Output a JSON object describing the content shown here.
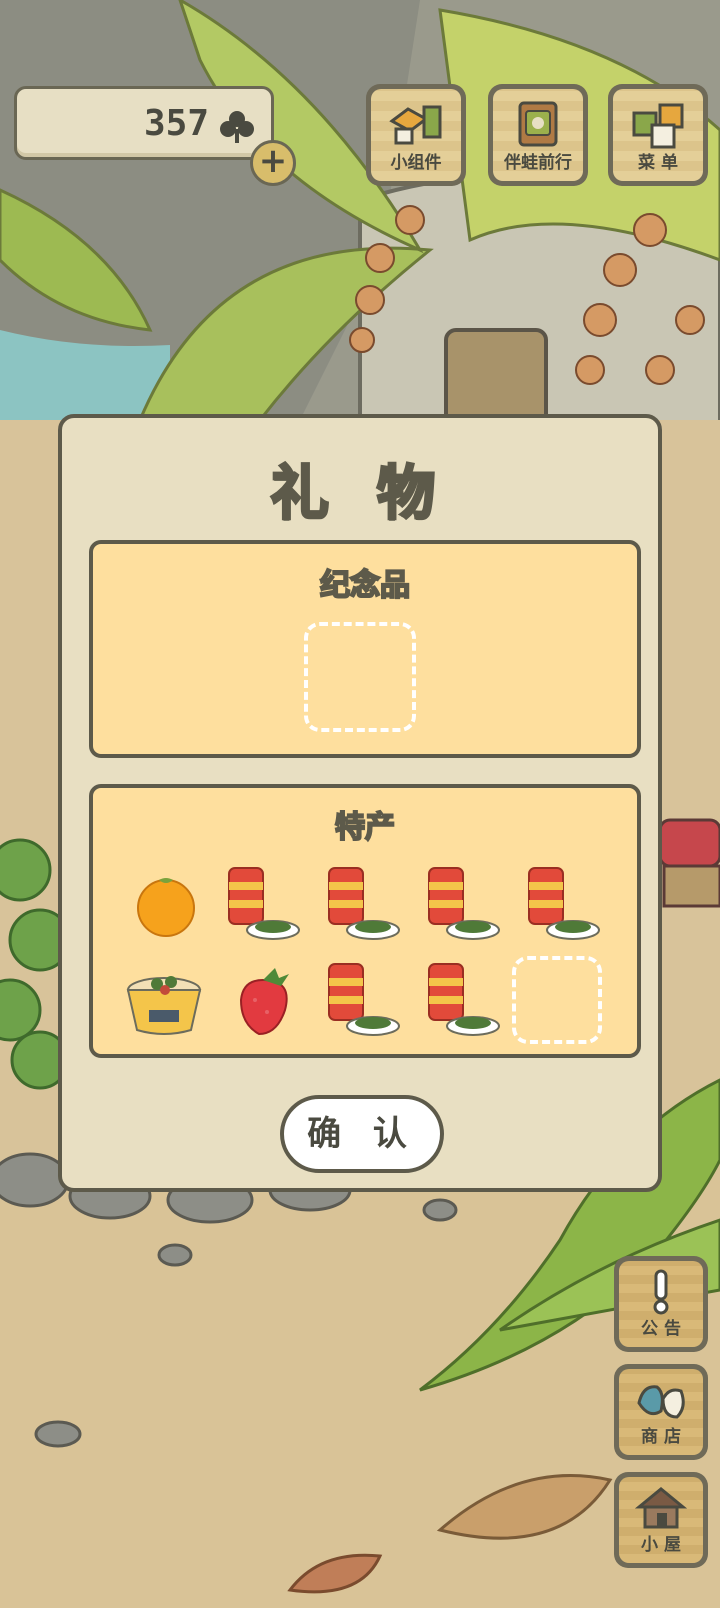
{
  "header": {
    "clover_count": "357",
    "add_clover_label": "+",
    "buttons": [
      {
        "label": "小组件",
        "icon": "widget-icon"
      },
      {
        "label": "伴蛙前行",
        "icon": "frog-journey-icon"
      },
      {
        "label": "菜 单",
        "icon": "menu-icon"
      }
    ]
  },
  "side_buttons": [
    {
      "label": "公 告",
      "icon": "exclamation-icon"
    },
    {
      "label": "商 店",
      "icon": "shop-bags-icon"
    },
    {
      "label": "小 屋",
      "icon": "house-icon"
    }
  ],
  "dialog": {
    "title": "礼 物",
    "souvenir": {
      "title": "纪念品",
      "slots": [
        "empty"
      ]
    },
    "specialty": {
      "title": "特产",
      "items": [
        "orange-icon",
        "canned-food-icon",
        "canned-food-icon",
        "canned-food-icon",
        "canned-food-icon",
        "noodle-bowl-icon",
        "strawberry-icon",
        "canned-food-icon",
        "canned-food-icon",
        "empty"
      ]
    },
    "confirm_label": "确 认"
  },
  "colors": {
    "panel_bg": "#fedf9e",
    "dialog_bg": "#e8dfc2",
    "outline": "#5d5a4a"
  }
}
